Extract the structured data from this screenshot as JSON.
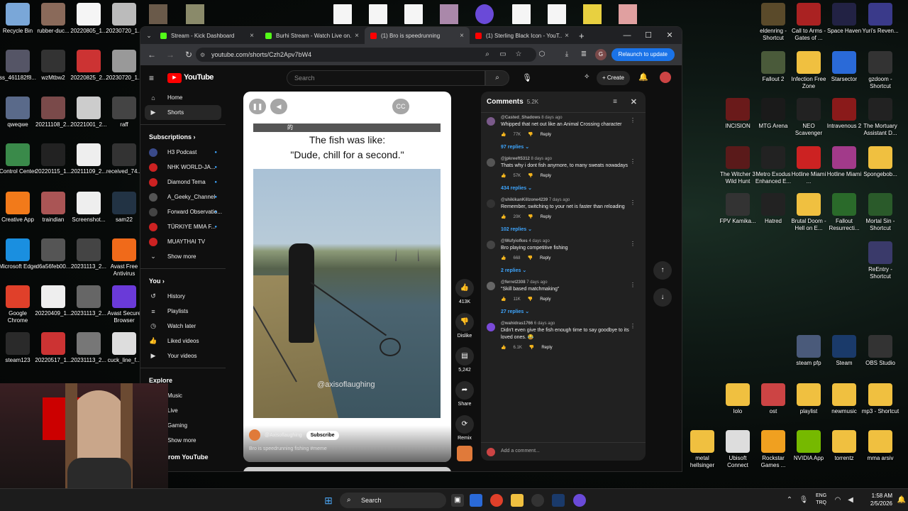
{
  "desktop_left": [
    {
      "label": "Recycle Bin",
      "color": "#7aa7d8"
    },
    {
      "label": "rubber-duc...",
      "color": "#8a6a5a"
    },
    {
      "label": "20220805_1...",
      "color": "#f5f5f5"
    },
    {
      "label": "20230720_1...",
      "color": "#bbb"
    },
    {
      "label": "ss_461182f8...",
      "color": "#556"
    },
    {
      "label": "wzMtbw2",
      "color": "#333"
    },
    {
      "label": "20220825_2...",
      "color": "#c33"
    },
    {
      "label": "20230720_1...",
      "color": "#999"
    },
    {
      "label": "qweqwe",
      "color": "#5a6a8a"
    },
    {
      "label": "20211108_2...",
      "color": "#7a4a4a"
    },
    {
      "label": "20221001_2...",
      "color": "#ccc"
    },
    {
      "label": "raff",
      "color": "#444"
    },
    {
      "label": "Control Center",
      "color": "#3a8a4a"
    },
    {
      "label": "20220115_1...",
      "color": "#222"
    },
    {
      "label": "20211109_2...",
      "color": "#eee"
    },
    {
      "label": "received_74...",
      "color": "#333"
    },
    {
      "label": "Creative App",
      "color": "#f27a1a"
    },
    {
      "label": "traindian",
      "color": "#a55"
    },
    {
      "label": "Screenshot...",
      "color": "#eee"
    },
    {
      "label": "sam22",
      "color": "#234"
    },
    {
      "label": "Microsoft Edge",
      "color": "#1a8fe0"
    },
    {
      "label": "d6a56feb00...",
      "color": "#555"
    },
    {
      "label": "20231113_2...",
      "color": "#444"
    },
    {
      "label": "Avast Free Antivirus",
      "color": "#f06a1a"
    },
    {
      "label": "Google Chrome",
      "color": "#e0402a"
    },
    {
      "label": "20220409_1...",
      "color": "#eee"
    },
    {
      "label": "20231113_2...",
      "color": "#666"
    },
    {
      "label": "Avast Secure Browser",
      "color": "#6a3ad8"
    },
    {
      "label": "steam123",
      "color": "#2a2a2a"
    },
    {
      "label": "20220517_1...",
      "color": "#c33"
    },
    {
      "label": "20231113_2...",
      "color": "#777"
    },
    {
      "label": "cuck_line_f...",
      "color": "#ddd"
    }
  ],
  "desktop_right": [
    {
      "label": "eldenring - Shortcut",
      "color": "#5a4a2a"
    },
    {
      "label": "Call to Arms - Gates of ...",
      "color": "#a22"
    },
    {
      "label": "Space Haven",
      "color": "#224"
    },
    {
      "label": "Yuri's Reven...",
      "color": "#3a3a8a"
    },
    {
      "label": "Fallout 2",
      "color": "#4a5a3a"
    },
    {
      "label": "Infection Free Zone",
      "color": "#f0c040"
    },
    {
      "label": "Starsector",
      "color": "#2a6ad8"
    },
    {
      "label": "gzdoom - Shortcut",
      "color": "#333"
    },
    {
      "label": "INCISION",
      "color": "#6a1a1a"
    },
    {
      "label": "MTG Arena",
      "color": "#1a1a1a"
    },
    {
      "label": "NEO Scavenger",
      "color": "#222"
    },
    {
      "label": "Intravenous 2",
      "color": "#8a1a1a"
    },
    {
      "label": "The Mortuary Assistant D...",
      "color": "#222"
    },
    {
      "label": "The Witcher 3 Wild Hunt",
      "color": "#5a1a1a"
    },
    {
      "label": "Metro Exodus Enhanced E...",
      "color": "#222"
    },
    {
      "label": "Hotline Miami ...",
      "color": "#c22"
    },
    {
      "label": "Hotline Miami",
      "color": "#a23a8a"
    },
    {
      "label": "Spongebob...",
      "color": "#f0c040"
    },
    {
      "label": "FPV Kamika...",
      "color": "#333"
    },
    {
      "label": "Hatred",
      "color": "#222"
    },
    {
      "label": "Brutal Doom - Hell on E...",
      "color": "#f0c040"
    },
    {
      "label": "Fallout Resurrecti...",
      "color": "#2a6a2a"
    },
    {
      "label": "Mortal Sin - Shortcut",
      "color": "#2a5a2a"
    },
    {
      "label": "ReEntry - Shortcut",
      "color": "#3a3a6a"
    },
    {
      "label": "steam pfp",
      "color": "#4a5a7a"
    },
    {
      "label": "Steam",
      "color": "#1a3a6a"
    },
    {
      "label": "OBS Studio",
      "color": "#333"
    },
    {
      "label": "lolo",
      "color": "#f0c040"
    },
    {
      "label": "ost",
      "color": "#c44"
    },
    {
      "label": "playlist",
      "color": "#f0c040"
    },
    {
      "label": "newmusic",
      "color": "#f0c040"
    },
    {
      "label": "mp3 - Shortcut",
      "color": "#f0c040"
    },
    {
      "label": "metal hellsinger",
      "color": "#f0c040"
    },
    {
      "label": "Ubisoft Connect",
      "color": "#ddd"
    },
    {
      "label": "Rockstar Games ...",
      "color": "#f0a020"
    },
    {
      "label": "NVIDIA App",
      "color": "#76b900"
    },
    {
      "label": "torrentz",
      "color": "#f0c040"
    },
    {
      "label": "mma arsiv",
      "color": "#f0c040"
    }
  ],
  "browser": {
    "tabs": [
      {
        "title": "Stream - Kick Dashboard",
        "color": "#53fc18"
      },
      {
        "title": "Burhi Stream - Watch Live on...",
        "color": "#53fc18"
      },
      {
        "title": "(1) Bro is speedrunning",
        "color": "#ff0000"
      },
      {
        "title": "(1) Sterling Black Icon - YouT...",
        "color": "#ff0000"
      }
    ],
    "url": "youtube.com/shorts/Czh2Apv7bW4",
    "relaunch": "Relaunch to update"
  },
  "youtube": {
    "logo": "YouTube",
    "search_placeholder": "Search",
    "create": "Create",
    "nav": [
      {
        "label": "Home",
        "icon": "⌂"
      },
      {
        "label": "Shorts",
        "icon": "▶"
      }
    ],
    "subscriptions_title": "Subscriptions",
    "subscriptions": [
      {
        "label": "H3 Podcast",
        "color": "#3a4a8a"
      },
      {
        "label": "NHK WORLD-JA...",
        "color": "#c22"
      },
      {
        "label": "Diamond Tema",
        "color": "#c22"
      },
      {
        "label": "A_Geeky_Channel",
        "color": "#555"
      },
      {
        "label": "Forward Observatio...",
        "color": "#444"
      },
      {
        "label": "TÜRKIYE MMA F...",
        "color": "#c22"
      },
      {
        "label": "MUAYTHAI TV",
        "color": "#c22"
      }
    ],
    "show_more": "Show more",
    "you_title": "You",
    "you": [
      {
        "label": "History",
        "icon": "↺"
      },
      {
        "label": "Playlists",
        "icon": "≡"
      },
      {
        "label": "Watch later",
        "icon": "◷"
      },
      {
        "label": "Liked videos",
        "icon": "👍"
      },
      {
        "label": "Your videos",
        "icon": "▶"
      }
    ],
    "explore_title": "Explore",
    "explore": [
      "Music",
      "Live",
      "Gaming",
      "Show more"
    ],
    "more_from": "More from YouTube"
  },
  "short": {
    "caption_line1": "The fish was like:",
    "caption_line2": "\"Dude, chill for a second.\"",
    "watermark": "@axisoflaughing",
    "channel": "@Axisoflaughing",
    "subscribe": "Subscribe",
    "title": "Bro is speedrunning fishing #meme",
    "tag": "的",
    "actions": [
      {
        "icon": "👍",
        "label": "413K"
      },
      {
        "icon": "👎",
        "label": "Dislike"
      },
      {
        "icon": "▤",
        "label": "5,242"
      },
      {
        "icon": "➦",
        "label": "Share"
      },
      {
        "icon": "⟳",
        "label": "Remix"
      }
    ]
  },
  "comments": {
    "title": "Comments",
    "count": "5.2K",
    "add": "Add a comment...",
    "items": [
      {
        "author": "@Casted_Shadows",
        "time": "8 days ago",
        "text": "Whipped that net out like an Animal Crossing character",
        "likes": "77K",
        "replies": "97 replies",
        "avatar": "#7a5a8a"
      },
      {
        "author": "@jpkreeft5312",
        "time": "8 days ago",
        "text": "Thats why i dont fish anymore, to many sweats nowadays",
        "likes": "57K",
        "replies": "434 replies",
        "avatar": "#555"
      },
      {
        "author": "@shikikanKillzone4239",
        "time": "7 days ago",
        "text": "Remember, switching to your net is faster than reloading",
        "likes": "20K",
        "replies": "102 replies",
        "avatar": "#333"
      },
      {
        "author": "@Wufyiofkes",
        "time": "4 days ago",
        "text": "Bro playing competitive fishing",
        "likes": "668",
        "replies": "2 replies",
        "avatar": "#444"
      },
      {
        "author": "@ferret2308",
        "time": "7 days ago",
        "text": "\"Skill based matchmaking\"",
        "likes": "11K",
        "replies": "27 replies",
        "avatar": "#666"
      },
      {
        "author": "@wahidras1766",
        "time": "6 days ago",
        "text": "Didn't even give the fish enough time to say goodbye to its loved ones. 😂",
        "likes": "6.1K",
        "replies": "",
        "avatar": "#7a4ad8"
      }
    ],
    "reply": "Reply"
  },
  "taskbar": {
    "search": "Search",
    "lang1": "ENG",
    "lang2": "TRQ",
    "time": "1:58 AM",
    "date": "2/5/2026"
  }
}
